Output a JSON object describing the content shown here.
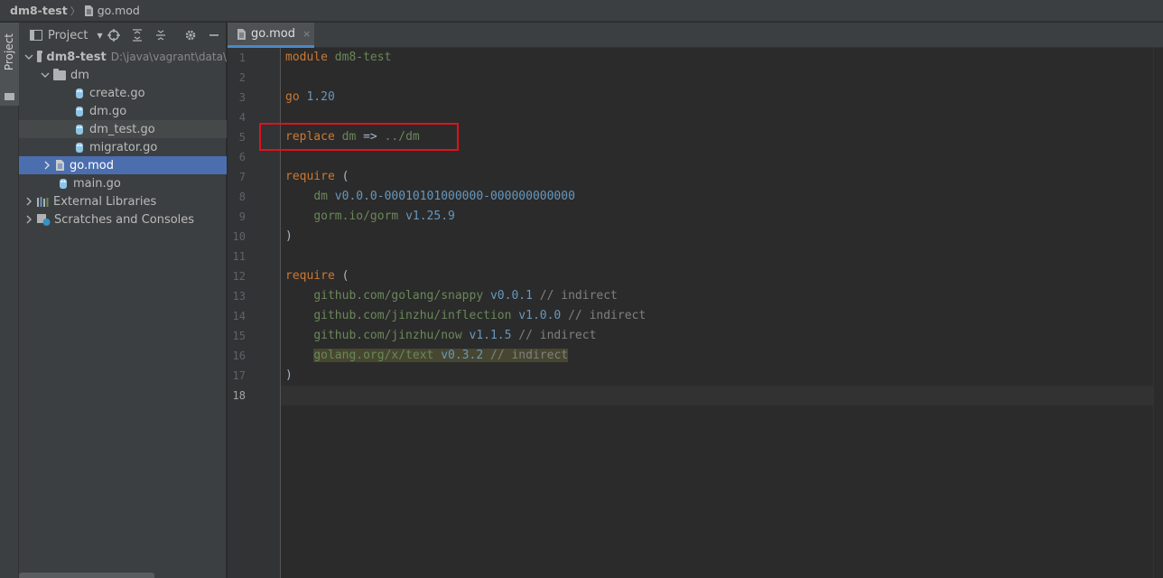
{
  "breadcrumb": {
    "project": "dm8-test",
    "separator": "〉",
    "file": "go.mod"
  },
  "toolstrip": {
    "project_label": "Project"
  },
  "project_panel": {
    "title": "Project",
    "tree": [
      {
        "label": "dm8-test",
        "hint": "D:\\java\\vagrant\\data\\",
        "type": "folder",
        "expanded": true
      },
      {
        "label": "dm",
        "type": "folder",
        "expanded": true
      },
      {
        "label": "create.go",
        "type": "go"
      },
      {
        "label": "dm.go",
        "type": "go"
      },
      {
        "label": "dm_test.go",
        "type": "go"
      },
      {
        "label": "migrator.go",
        "type": "go"
      },
      {
        "label": "go.mod",
        "type": "mod"
      },
      {
        "label": "main.go",
        "type": "go"
      },
      {
        "label": "External Libraries",
        "type": "lib"
      },
      {
        "label": "Scratches and Consoles",
        "type": "scratch"
      }
    ]
  },
  "editor": {
    "tab": {
      "label": "go.mod",
      "close": "×"
    },
    "current_line": 18,
    "lines": [
      {
        "n": "1",
        "tokens": [
          [
            "kw",
            "module "
          ],
          [
            "mod",
            "dm8-test"
          ]
        ]
      },
      {
        "n": "2",
        "tokens": []
      },
      {
        "n": "3",
        "tokens": [
          [
            "kw",
            "go "
          ],
          [
            "ver",
            "1.20"
          ]
        ]
      },
      {
        "n": "4",
        "tokens": []
      },
      {
        "n": "5",
        "tokens": [
          [
            "kw",
            "replace "
          ],
          [
            "mod",
            "dm"
          ],
          [
            "plain",
            " => "
          ],
          [
            "mod",
            "../dm"
          ]
        ]
      },
      {
        "n": "6",
        "tokens": []
      },
      {
        "n": "7",
        "tokens": [
          [
            "kw",
            "require "
          ],
          [
            "plain",
            "("
          ]
        ]
      },
      {
        "n": "8",
        "tokens": [
          [
            "plain",
            "    "
          ],
          [
            "mod",
            "dm "
          ],
          [
            "ver",
            "v0.0.0-00010101000000-000000000000"
          ]
        ]
      },
      {
        "n": "9",
        "tokens": [
          [
            "plain",
            "    "
          ],
          [
            "mod",
            "gorm.io/gorm "
          ],
          [
            "ver",
            "v1.25.9"
          ]
        ]
      },
      {
        "n": "10",
        "tokens": [
          [
            "plain",
            ")"
          ]
        ]
      },
      {
        "n": "11",
        "tokens": []
      },
      {
        "n": "12",
        "tokens": [
          [
            "kw",
            "require "
          ],
          [
            "plain",
            "("
          ]
        ]
      },
      {
        "n": "13",
        "tokens": [
          [
            "plain",
            "    "
          ],
          [
            "mod",
            "github.com/golang/snappy "
          ],
          [
            "ver",
            "v0.0.1 "
          ],
          [
            "cmt",
            "// indirect"
          ]
        ]
      },
      {
        "n": "14",
        "tokens": [
          [
            "plain",
            "    "
          ],
          [
            "mod",
            "github.com/jinzhu/inflection "
          ],
          [
            "ver",
            "v1.0.0 "
          ],
          [
            "cmt",
            "// indirect"
          ]
        ]
      },
      {
        "n": "15",
        "tokens": [
          [
            "plain",
            "    "
          ],
          [
            "mod",
            "github.com/jinzhu/now "
          ],
          [
            "ver",
            "v1.1.5 "
          ],
          [
            "cmt",
            "// indirect"
          ]
        ]
      },
      {
        "n": "16",
        "highlight": true,
        "tokens": [
          [
            "plain",
            "    "
          ],
          [
            "mod",
            "golang.org/x/text "
          ],
          [
            "ver",
            "v0.3.2 "
          ],
          [
            "cmt",
            "// indirect"
          ]
        ]
      },
      {
        "n": "17",
        "tokens": [
          [
            "plain",
            ")"
          ]
        ]
      },
      {
        "n": "18",
        "tokens": []
      }
    ]
  }
}
